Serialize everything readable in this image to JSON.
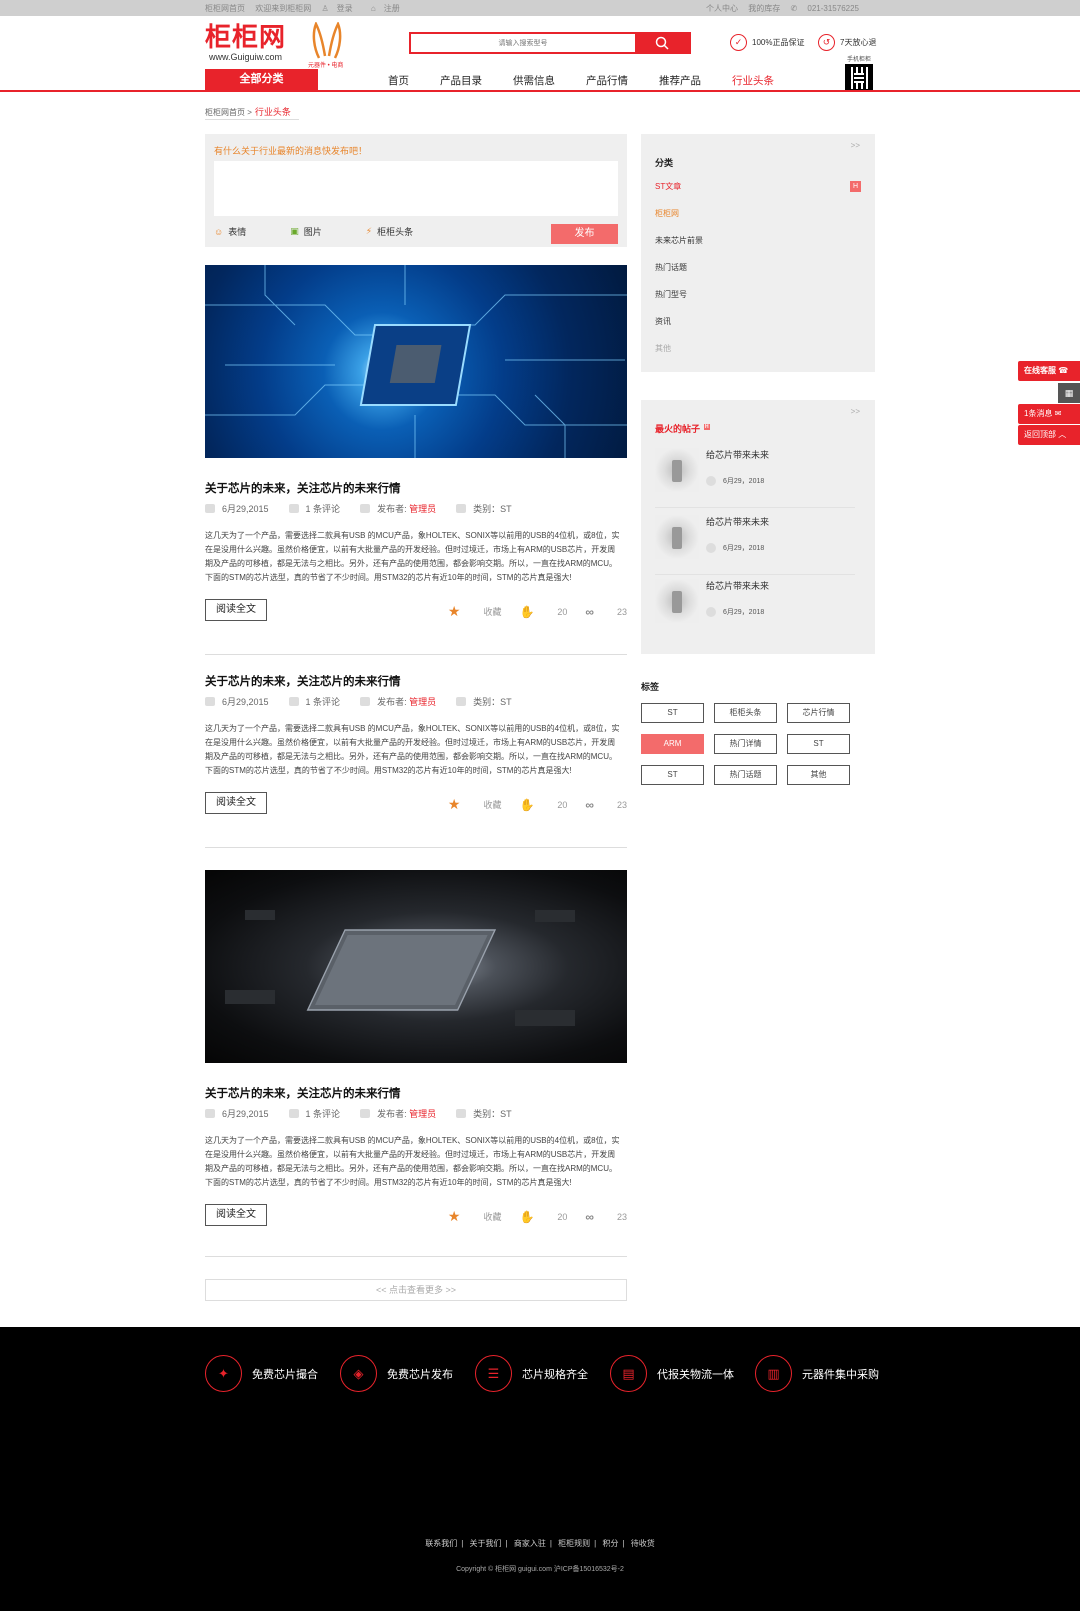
{
  "topbar": {
    "left": [
      "柜柜网首页",
      "欢迎来到柜柜网",
      "登录",
      "注册"
    ],
    "right": [
      "个人中心",
      "我的库存",
      "021-31576225"
    ]
  },
  "header": {
    "logo_cn": "柜柜网",
    "logo_en": "www.Guiguiw.com",
    "mascot_tag": "元器件 • 电商",
    "search_placeholder": "请输入搜索型号",
    "guarantee_1": "100%正品保证",
    "guarantee_2": "7天放心退",
    "qr_label": "手机柜柜"
  },
  "nav": {
    "all_categories": "全部分类",
    "items": [
      "首页",
      "产品目录",
      "供需信息",
      "产品行情",
      "推荐产品",
      "行业头条"
    ]
  },
  "breadcrumb": {
    "home": "柜柜网首页 >",
    "current": "行业头条"
  },
  "post_box": {
    "hint": "有什么关于行业最新的消息快发布吧！",
    "tool_emoji": "表情",
    "tool_image": "图片",
    "tool_headline": "柜柜头条",
    "submit": "发布"
  },
  "articles": [
    {
      "title": "关于芯片的未来，关注芯片的未来行情",
      "date": "6月29,2015",
      "comments": "1 条评论",
      "publisher_label": "发布者:",
      "publisher": "管理员",
      "category": "类别：ST",
      "body": "这几天为了一个产品，需要选择二款具有USB 的MCU产品，象HOLTEK、SONIX等以前用的USB的4位机，或8位，实在是没用什么兴趣。虽然价格便宜，以前有大批量产品的开发经验。但时过境迁，市场上有ARM的USB芯片，开发周期及产品的可移植，都是无法与之相比。另外，还有产品的使用范围，都会影响交期。所以，一直在找ARM的MCU。下面的STM的芯片选型，真的节省了不少时间。用STM32的芯片有近10年的时间，STM的芯片真是强大!",
      "read_more": "阅读全文",
      "fav": "收藏",
      "likes": "20",
      "shares": "23"
    },
    {
      "title": "关于芯片的未来，关注芯片的未来行情",
      "date": "6月29,2015",
      "comments": "1 条评论",
      "publisher_label": "发布者:",
      "publisher": "管理员",
      "category": "类别：ST",
      "body": "这几天为了一个产品，需要选择二款具有USB 的MCU产品，象HOLTEK、SONIX等以前用的USB的4位机，或8位，实在是没用什么兴趣。虽然价格便宜，以前有大批量产品的开发经验。但时过境迁，市场上有ARM的USB芯片，开发周期及产品的可移植，都是无法与之相比。另外，还有产品的使用范围，都会影响交期。所以，一直在找ARM的MCU。下面的STM的芯片选型，真的节省了不少时间。用STM32的芯片有近10年的时间，STM的芯片真是强大!",
      "read_more": "阅读全文",
      "fav": "收藏",
      "likes": "20",
      "shares": "23"
    },
    {
      "title": "关于芯片的未来，关注芯片的未来行情",
      "date": "6月29,2015",
      "comments": "1 条评论",
      "publisher_label": "发布者:",
      "publisher": "管理员",
      "category": "类别：ST",
      "body": "这几天为了一个产品，需要选择二款具有USB 的MCU产品，象HOLTEK、SONIX等以前用的USB的4位机，或8位，实在是没用什么兴趣。虽然价格便宜，以前有大批量产品的开发经验。但时过境迁，市场上有ARM的USB芯片，开发周期及产品的可移植，都是无法与之相比。另外，还有产品的使用范围，都会影响交期。所以，一直在找ARM的MCU。下面的STM的芯片选型，真的节省了不少时间。用STM32的芯片有近10年的时间，STM的芯片真是强大!",
      "read_more": "阅读全文",
      "fav": "收藏",
      "likes": "20",
      "shares": "23"
    }
  ],
  "load_more": "<<   点击查看更多   >>",
  "sidebar": {
    "more": ">>",
    "categories_title": "分类",
    "categories": [
      "ST文章",
      "柜柜网",
      "未来芯片前景",
      "热门话题",
      "热门型号",
      "资讯",
      "其他"
    ],
    "hot_badge": "H",
    "hot_title": "最火的帖子",
    "hot_posts": [
      {
        "title": "给芯片带来未来",
        "date": "6月29，2018"
      },
      {
        "title": "给芯片带来未来",
        "date": "6月29，2018"
      },
      {
        "title": "给芯片带来未来",
        "date": "6月29，2018"
      }
    ],
    "tags_title": "标签",
    "tags": [
      "ST",
      "柜柜头条",
      "芯片行情",
      "ARM",
      "热门详情",
      "ST",
      "ST",
      "热门话题",
      "其他"
    ]
  },
  "float": {
    "service": "在线客服",
    "messages": "1条消息",
    "back_top": "返回顶部"
  },
  "footer": {
    "features": [
      "免费芯片撮合",
      "免费芯片发布",
      "芯片规格齐全",
      "代报关物流一体",
      "元器件集中采购"
    ],
    "links": [
      "联系我们",
      "关于我们",
      "商家入驻",
      "柜柜规则",
      "积分",
      "待收货"
    ],
    "copyright": "Copyright  ©  柜柜网 guigui.com 沪ICP备15016532号-2"
  },
  "colors": {
    "brand": "#e8232b",
    "accent_orange": "#e8852b",
    "button_pink": "#f36b6b"
  }
}
